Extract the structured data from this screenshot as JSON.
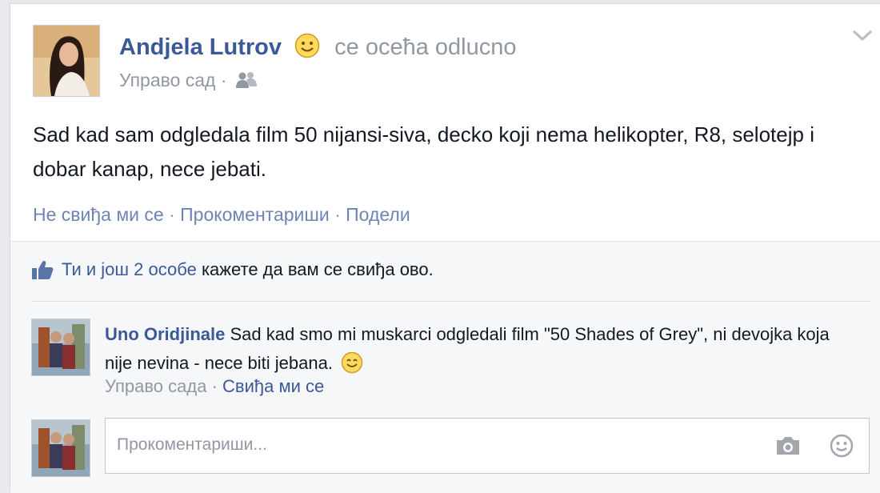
{
  "post": {
    "author": "Andjela Lutrov",
    "feeling": "се осећа odlucno",
    "timestamp": "Управо сад",
    "audience_separator": "·",
    "audience_icon": "friends-icon",
    "text": "Sad kad sam odgledala film 50 nijansi-siva, decko koji nema helikopter, R8, selotejp i dobar kanap, nece jebati.",
    "actions": {
      "unlike": "Не свиђа ми се",
      "comment": "Прокоментариши",
      "share": "Подели",
      "sep": "·"
    }
  },
  "likes": {
    "icon": "thumbs-up-icon",
    "link_text": "Ти и још 2 особе",
    "rest_text": " кажете да вам се свиђа ово."
  },
  "comment": {
    "author": "Uno Oridjinale",
    "text": "Sad kad smo mi muskarci odgledali film \"50 Shades of Grey\", ni devojka koja nije nevina - nece biti jebana.",
    "timestamp": "Управо сада",
    "sep": "·",
    "like_label": "Свиђа ми се"
  },
  "composer": {
    "placeholder": "Прокоментариши...",
    "camera_icon": "camera-icon",
    "emoji_icon": "smiley-icon"
  },
  "colors": {
    "link_blue": "#3b5998",
    "meta_gray": "#9197a3",
    "panel_bg": "#f6f7f8"
  }
}
